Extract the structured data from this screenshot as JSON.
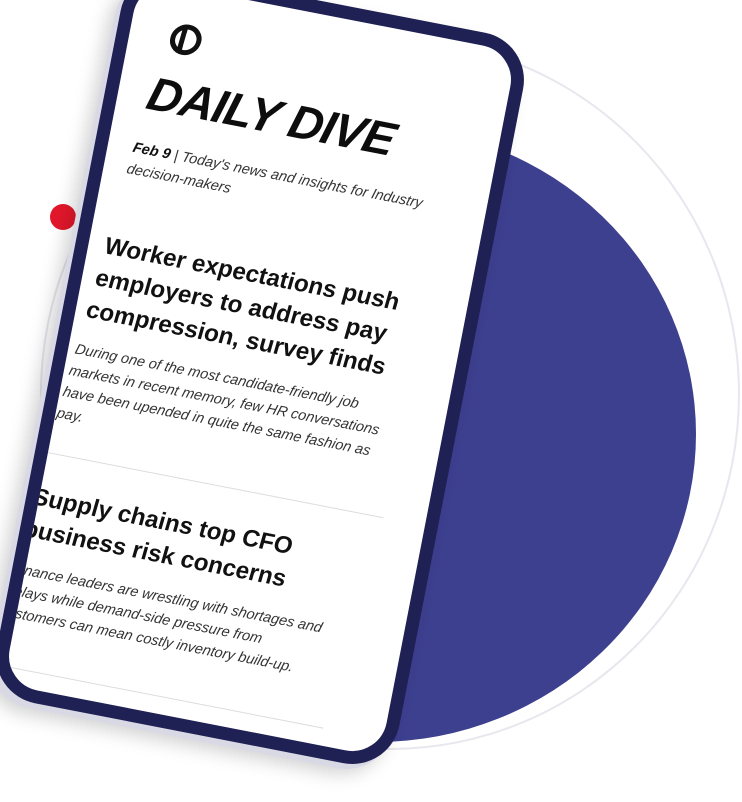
{
  "brand": {
    "title": "DAILY DIVE",
    "logo_icon": "industry-dive-logo"
  },
  "dateline": {
    "date": "Feb 9",
    "separator": " | ",
    "tagline": "Today's news and insights for Industry decision-makers"
  },
  "articles": [
    {
      "headline": "Worker expectations push employers to address pay compression, survey finds",
      "summary": "During one of the most candidate-friendly job markets in recent memory, few HR conversations have been upended in quite the same fashion as pay."
    },
    {
      "headline": "Supply chains top CFO business risk concerns",
      "summary": "Finance leaders are wrestling with shortages and delays while demand-side pressure from customers can mean costly inventory build-up."
    }
  ],
  "colors": {
    "disc": "#3d3f8f",
    "phone_frame": "#1f2053",
    "accent_dot": "#e3172b",
    "ring": "#e7e7ee"
  }
}
